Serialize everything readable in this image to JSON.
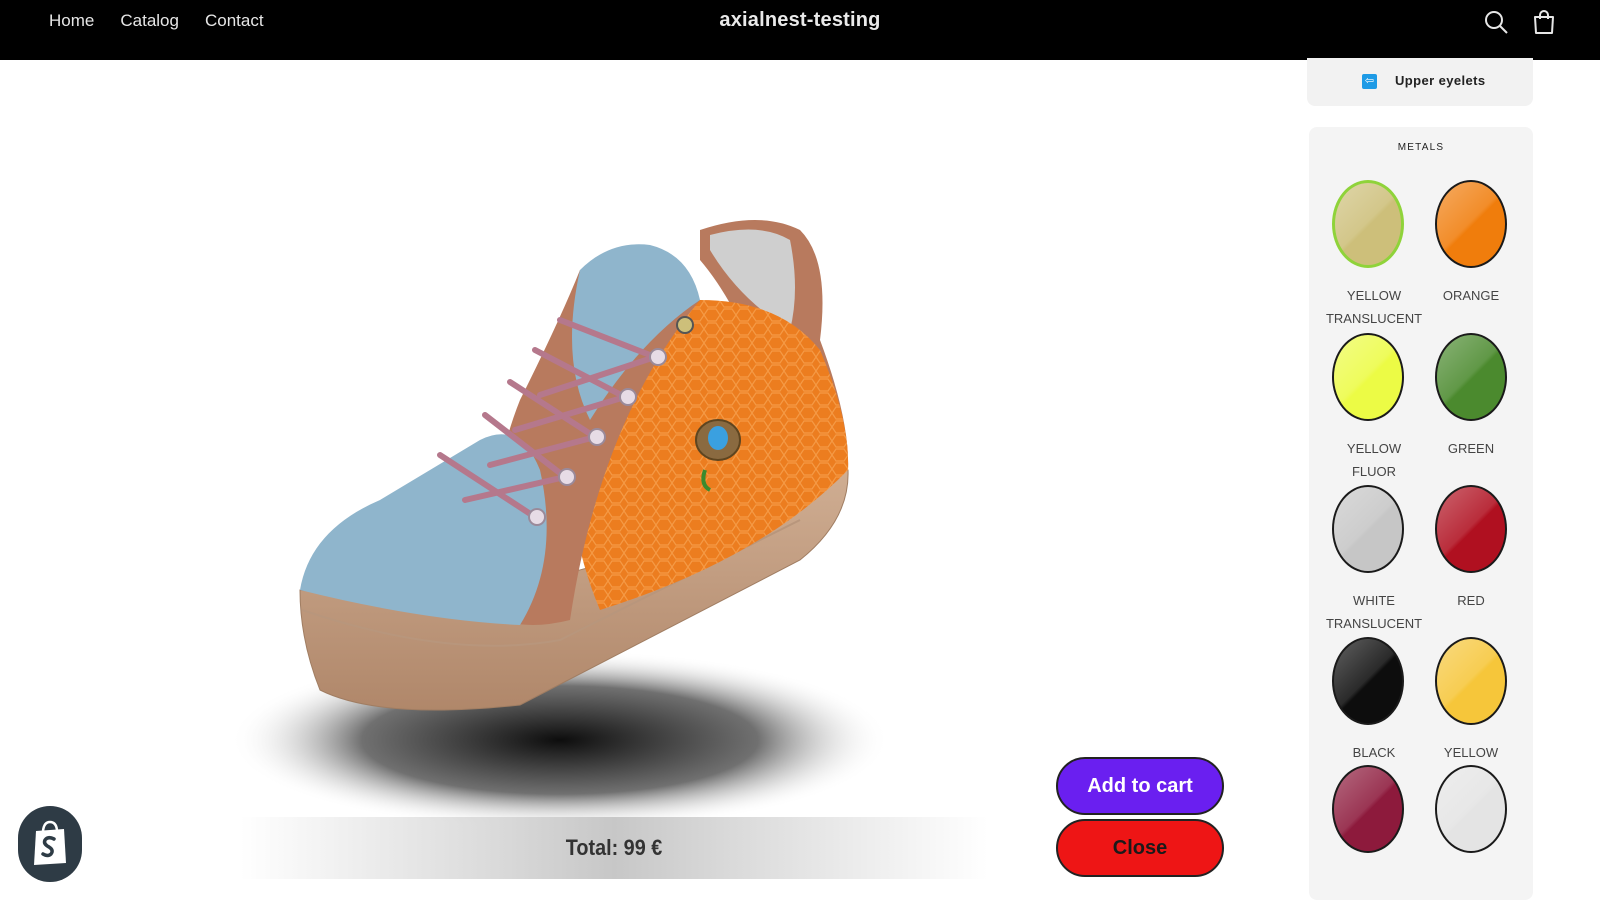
{
  "header": {
    "nav": [
      "Home",
      "Catalog",
      "Contact"
    ],
    "store_name": "axialnest-testing",
    "search_icon": "search-icon",
    "cart_icon": "cart-icon"
  },
  "configurator": {
    "current_part": "Upper eyelets",
    "back_icon": "arrow-left-icon",
    "section_heading": "METALS",
    "swatches": [
      {
        "name": "YELLOW TRANSLUCENT",
        "line1": "YELLOW",
        "line2": "TRANSLUCENT",
        "color": "#cdbf7a",
        "selected": true
      },
      {
        "name": "ORANGE",
        "line1": "ORANGE",
        "line2": "",
        "color": "#f07d0c",
        "selected": false
      },
      {
        "name": "YELLOW FLUOR",
        "line1": "YELLOW",
        "line2": "FLUOR",
        "color": "#ecfb45",
        "selected": false
      },
      {
        "name": "GREEN",
        "line1": "GREEN",
        "line2": "",
        "color": "#4b8a2e",
        "selected": false
      },
      {
        "name": "WHITE TRANSLUCENT",
        "line1": "WHITE",
        "line2": "TRANSLUCENT",
        "color": "#c6c6c6",
        "selected": false
      },
      {
        "name": "RED",
        "line1": "RED",
        "line2": "",
        "color": "#b01020",
        "selected": false
      },
      {
        "name": "BLACK",
        "line1": "BLACK",
        "line2": "",
        "color": "#0d0d0d",
        "selected": false
      },
      {
        "name": "YELLOW",
        "line1": "YELLOW",
        "line2": "",
        "color": "#f6c63a",
        "selected": false
      },
      {
        "name": "",
        "line1": "",
        "line2": "",
        "color": "#8d1a3c",
        "selected": false
      },
      {
        "name": "",
        "line1": "",
        "line2": "",
        "color": "#e4e4e4",
        "selected": false
      }
    ]
  },
  "product": {
    "total_label": "Total: 99 €"
  },
  "actions": {
    "add_to_cart": "Add to cart",
    "close": "Close"
  },
  "colors": {
    "add_to_cart_bg": "#6a1ff0",
    "close_bg": "#ee1515",
    "toe_blue": "#8fb5cc",
    "suede_brown": "#b87a5e",
    "quarter_orange": "#e87a1e",
    "sole": "#c4a184"
  },
  "badge": {
    "icon": "shopify-bag-icon"
  }
}
